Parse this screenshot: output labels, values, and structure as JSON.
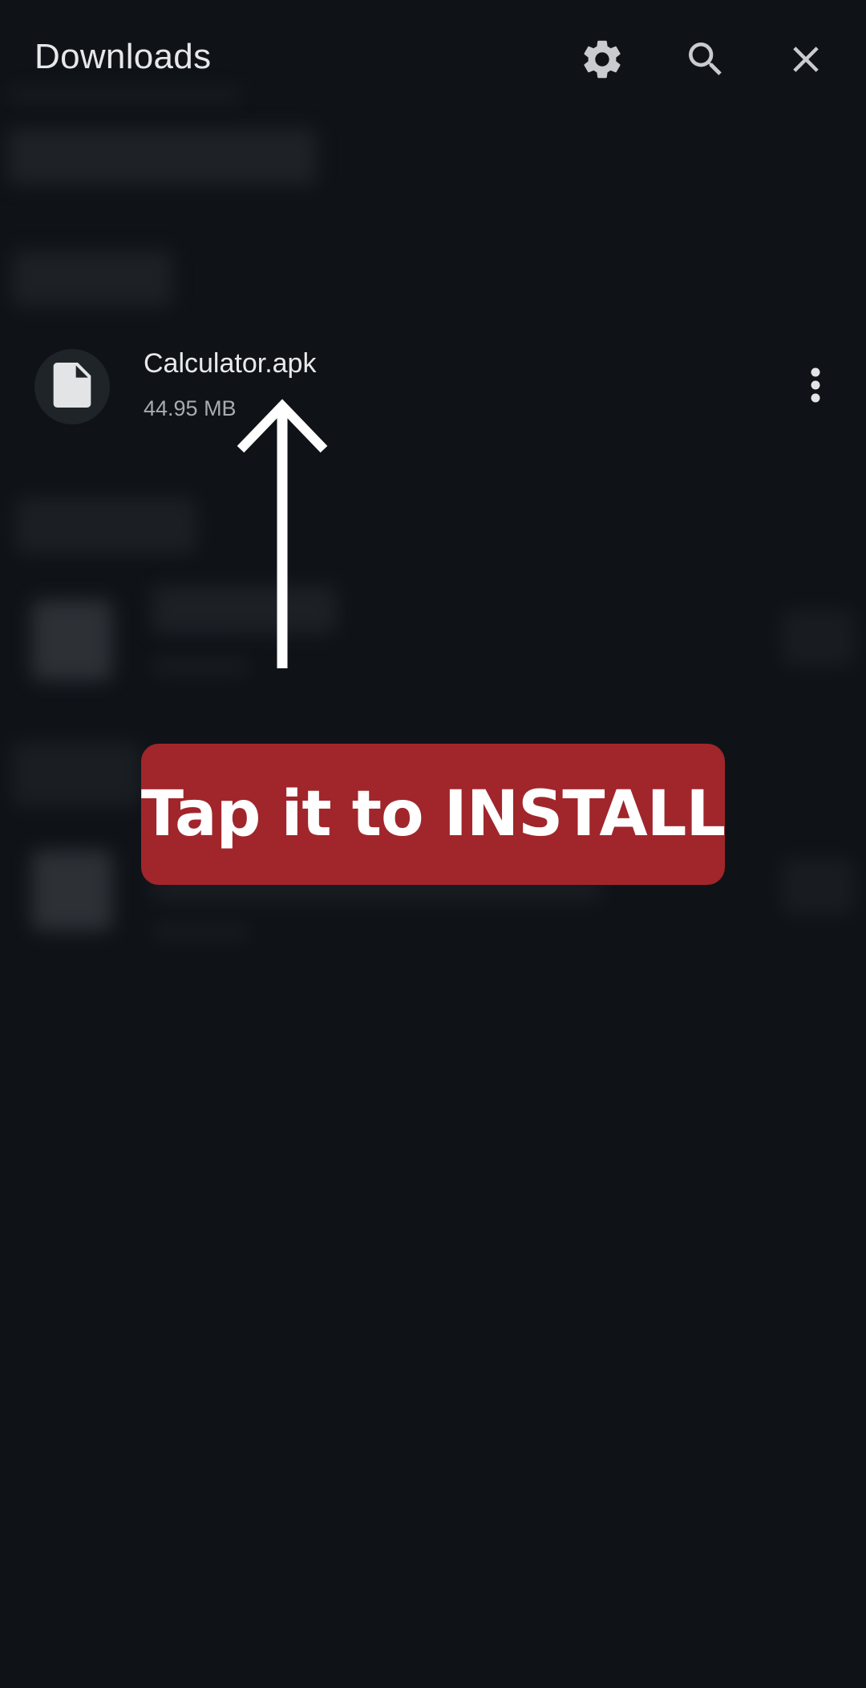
{
  "header": {
    "title": "Downloads",
    "settings_icon": "gear-icon",
    "search_icon": "search-icon",
    "close_icon": "close-icon"
  },
  "download_item": {
    "file_name": "Calculator.apk",
    "file_size": "44.95 MB",
    "icon": "file-icon",
    "menu_icon": "more-vert-icon"
  },
  "overlay": {
    "arrow_icon": "up-arrow-icon",
    "callout_text": "Tap it to INSTALL"
  },
  "colors": {
    "background": "#0f1318",
    "text_primary": "#e8e9eb",
    "text_secondary": "#a8acb1",
    "callout": "#a0262b"
  }
}
